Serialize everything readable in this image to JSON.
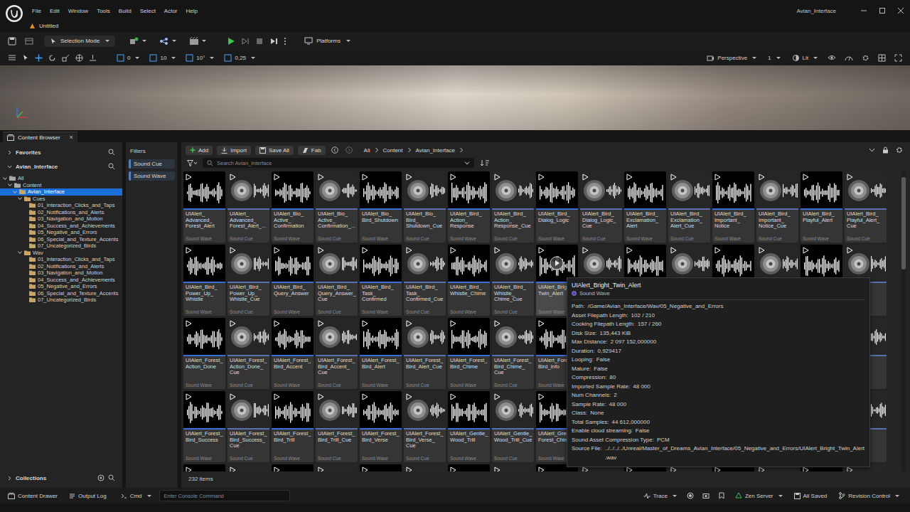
{
  "window": {
    "title": "Avian_Interface",
    "menu": [
      "File",
      "Edit",
      "Window",
      "Tools",
      "Build",
      "Select",
      "Actor",
      "Help"
    ],
    "level_tab": "Untitled"
  },
  "main_toolbar": {
    "mode": "Selection Mode",
    "platforms": "Platforms"
  },
  "viewport_toolbar": {
    "snaps": [
      "0",
      "10",
      "10°",
      "0,25"
    ],
    "view": "Perspective",
    "camera_speed": "1",
    "view_mode": "Lit"
  },
  "content_browser": {
    "tab": "Content Browser",
    "close": "×",
    "add": "Add",
    "import": "Import",
    "save_all": "Save All",
    "fab": "Fab",
    "breadcrumb": [
      "All",
      "Content",
      "Avian_Interface"
    ],
    "search_placeholder": "Search Avian_Interface",
    "item_count": "232 items"
  },
  "sidebar": {
    "favorites": "Favorites",
    "source": "Avian_Interface",
    "collections": "Collections",
    "tree": [
      {
        "label": "All",
        "depth": 0,
        "kind": "branch",
        "expanded": true,
        "selected": false
      },
      {
        "label": "Content",
        "depth": 1,
        "kind": "branch",
        "expanded": true,
        "selected": false
      },
      {
        "label": "Avian_Interface",
        "depth": 2,
        "kind": "branch",
        "expanded": true,
        "selected": true
      },
      {
        "label": "Cues",
        "depth": 3,
        "kind": "branch",
        "expanded": true,
        "selected": false
      },
      {
        "label": "01_Interaction_Clicks_and_Taps",
        "depth": 4,
        "kind": "leaf",
        "expanded": false,
        "selected": false
      },
      {
        "label": "02_Notifications_and_Alerts",
        "depth": 4,
        "kind": "leaf",
        "expanded": false,
        "selected": false
      },
      {
        "label": "03_Navigation_and_Motion",
        "depth": 4,
        "kind": "leaf",
        "expanded": false,
        "selected": false
      },
      {
        "label": "04_Success_and_Achievements",
        "depth": 4,
        "kind": "leaf",
        "expanded": false,
        "selected": false
      },
      {
        "label": "05_Negative_and_Errors",
        "depth": 4,
        "kind": "leaf",
        "expanded": false,
        "selected": false
      },
      {
        "label": "06_Special_and_Texture_Accents",
        "depth": 4,
        "kind": "leaf",
        "expanded": false,
        "selected": false
      },
      {
        "label": "07_Uncategorized_Birds",
        "depth": 4,
        "kind": "leaf",
        "expanded": false,
        "selected": false
      },
      {
        "label": "Wav",
        "depth": 3,
        "kind": "branch",
        "expanded": true,
        "selected": false
      },
      {
        "label": "01_Interaction_Clicks_and_Taps",
        "depth": 4,
        "kind": "leaf",
        "expanded": false,
        "selected": false
      },
      {
        "label": "02_Notifications_and_Alerts",
        "depth": 4,
        "kind": "leaf",
        "expanded": false,
        "selected": false
      },
      {
        "label": "03_Navigation_and_Motion",
        "depth": 4,
        "kind": "leaf",
        "expanded": false,
        "selected": false
      },
      {
        "label": "04_Success_and_Achievements",
        "depth": 4,
        "kind": "leaf",
        "expanded": false,
        "selected": false
      },
      {
        "label": "05_Negative_and_Errors",
        "depth": 4,
        "kind": "leaf",
        "expanded": false,
        "selected": false
      },
      {
        "label": "06_Special_and_Texture_Accents",
        "depth": 4,
        "kind": "leaf",
        "expanded": false,
        "selected": false
      },
      {
        "label": "07_Uncategorized_Birds",
        "depth": 4,
        "kind": "leaf",
        "expanded": false,
        "selected": false
      }
    ]
  },
  "filters": {
    "title": "Filters",
    "chips": [
      "Sound Cue",
      "Sound Wave"
    ]
  },
  "assets": [
    {
      "name": "UIAlert_Advanced_Forest_Alert",
      "type": "Sound Wave",
      "kind": "wave",
      "hovered": false
    },
    {
      "name": "UIAlert_Advanced_Forest_Alert_...",
      "type": "Sound Cue",
      "kind": "cue",
      "hovered": false
    },
    {
      "name": "UIAlert_Bio_Active_Confirmation",
      "type": "Sound Wave",
      "kind": "wave",
      "hovered": false
    },
    {
      "name": "UIAlert_Bio_Active_Confirmation_...",
      "type": "Sound Cue",
      "kind": "cue",
      "hovered": false
    },
    {
      "name": "UIAlert_Bio_Bird_Shutdown",
      "type": "Sound Wave",
      "kind": "wave",
      "hovered": false
    },
    {
      "name": "UIAlert_Bio_Bird_Shutdown_Cue",
      "type": "Sound Cue",
      "kind": "cue",
      "hovered": false
    },
    {
      "name": "UIAlert_Bird_Action_Response",
      "type": "Sound Wave",
      "kind": "wave",
      "hovered": false
    },
    {
      "name": "UIAlert_Bird_Action_Response_Cue",
      "type": "Sound Cue",
      "kind": "cue",
      "hovered": false
    },
    {
      "name": "UIAlert_Bird_Dialog_Logic",
      "type": "Sound Wave",
      "kind": "wave",
      "hovered": false
    },
    {
      "name": "UIAlert_Bird_Dialog_Logic_Cue",
      "type": "Sound Cue",
      "kind": "cue",
      "hovered": false
    },
    {
      "name": "UIAlert_Bird_Exclamation_Alert",
      "type": "Sound Wave",
      "kind": "wave",
      "hovered": false
    },
    {
      "name": "UIAlert_Bird_Exclamation_Alert_Cue",
      "type": "Sound Cue",
      "kind": "cue",
      "hovered": false
    },
    {
      "name": "UIAlert_Bird_Important_Notice",
      "type": "Sound Wave",
      "kind": "wave",
      "hovered": false
    },
    {
      "name": "UIAlert_Bird_Important_Notice_Cue",
      "type": "Sound Cue",
      "kind": "cue",
      "hovered": false
    },
    {
      "name": "UIAlert_Bird_Playful_Alert",
      "type": "Sound Wave",
      "kind": "wave",
      "hovered": false
    },
    {
      "name": "UIAlert_Bird_Playful_Alert_Cue",
      "type": "Sound Cue",
      "kind": "cue",
      "hovered": false
    },
    {
      "name": "UIAlert_Bird_Power_Up_Whistle",
      "type": "Sound Wave",
      "kind": "wave",
      "hovered": false
    },
    {
      "name": "UIAlert_Bird_Power_Up_Whistle_Cue",
      "type": "Sound Cue",
      "kind": "cue",
      "hovered": false
    },
    {
      "name": "UIAlert_Bird_Query_Answer",
      "type": "Sound Wave",
      "kind": "wave",
      "hovered": false
    },
    {
      "name": "UIAlert_Bird_Query_Answer_Cue",
      "type": "Sound Cue",
      "kind": "cue",
      "hovered": false
    },
    {
      "name": "UIAlert_Bird_Task_Confirmed",
      "type": "Sound Wave",
      "kind": "wave",
      "hovered": false
    },
    {
      "name": "UIAlert_Bird_Task_Confirmed_Cue",
      "type": "Sound Cue",
      "kind": "cue",
      "hovered": false
    },
    {
      "name": "UIAlert_Bird_Whistle_Chime",
      "type": "Sound Wave",
      "kind": "wave",
      "hovered": false
    },
    {
      "name": "UIAlert_Bird_Whistle_Chime_Cue",
      "type": "Sound Cue",
      "kind": "cue",
      "hovered": false
    },
    {
      "name": "UIAlert_Bright_Twin_Alert",
      "type": "Sound Wave",
      "kind": "wave",
      "hovered": true
    },
    {
      "name": "",
      "type": "",
      "kind": "cue",
      "hovered": false
    },
    {
      "name": "",
      "type": "",
      "kind": "wave",
      "hovered": false
    },
    {
      "name": "",
      "type": "",
      "kind": "cue",
      "hovered": false
    },
    {
      "name": "",
      "type": "",
      "kind": "wave",
      "hovered": false
    },
    {
      "name": "",
      "type": "",
      "kind": "cue",
      "hovered": false
    },
    {
      "name": "",
      "type": "",
      "kind": "wave",
      "hovered": false
    },
    {
      "name": "",
      "type": "",
      "kind": "cue",
      "hovered": false
    },
    {
      "name": "UIAlert_Forest_Action_Done",
      "type": "Sound Wave",
      "kind": "wave",
      "hovered": false
    },
    {
      "name": "UIAlert_Forest_Action_Done_Cue",
      "type": "Sound Cue",
      "kind": "cue",
      "hovered": false
    },
    {
      "name": "UIAlert_Forest_Bird_Accent",
      "type": "Sound Wave",
      "kind": "wave",
      "hovered": false
    },
    {
      "name": "UIAlert_Forest_Bird_Accent_Cue",
      "type": "Sound Cue",
      "kind": "cue",
      "hovered": false
    },
    {
      "name": "UIAlert_Forest_Bird_Alert",
      "type": "Sound Wave",
      "kind": "wave",
      "hovered": false
    },
    {
      "name": "UIAlert_Forest_Bird_Alert_Cue",
      "type": "Sound Cue",
      "kind": "cue",
      "hovered": false
    },
    {
      "name": "UIAlert_Forest_Bird_Chime",
      "type": "Sound Wave",
      "kind": "wave",
      "hovered": false
    },
    {
      "name": "UIAlert_Forest_Bird_Chime_Cue",
      "type": "Sound Cue",
      "kind": "cue",
      "hovered": false
    },
    {
      "name": "UIAlert_Forest_Bird_Info",
      "type": "Sound Wave",
      "kind": "wave",
      "hovered": false
    },
    {
      "name": "",
      "type": "",
      "kind": "cue",
      "hovered": false
    },
    {
      "name": "",
      "type": "",
      "kind": "wave",
      "hovered": false
    },
    {
      "name": "",
      "type": "",
      "kind": "cue",
      "hovered": false
    },
    {
      "name": "",
      "type": "",
      "kind": "wave",
      "hovered": false
    },
    {
      "name": "",
      "type": "",
      "kind": "cue",
      "hovered": false
    },
    {
      "name": "",
      "type": "",
      "kind": "wave",
      "hovered": false
    },
    {
      "name": "",
      "type": "",
      "kind": "cue",
      "hovered": false
    },
    {
      "name": "UIAlert_Forest_Bird_Success",
      "type": "Sound Wave",
      "kind": "wave",
      "hovered": false
    },
    {
      "name": "UIAlert_Forest_Bird_Success_Cue",
      "type": "Sound Cue",
      "kind": "cue",
      "hovered": false
    },
    {
      "name": "UIAlert_Forest_Bird_Trill",
      "type": "Sound Wave",
      "kind": "wave",
      "hovered": false
    },
    {
      "name": "UIAlert_Forest_Bird_Trill_Cue",
      "type": "Sound Cue",
      "kind": "cue",
      "hovered": false
    },
    {
      "name": "UIAlert_Forest_Bird_Verse",
      "type": "Sound Wave",
      "kind": "wave",
      "hovered": false
    },
    {
      "name": "UIAlert_Forest_Bird_Verse_Cue",
      "type": "Sound Cue",
      "kind": "cue",
      "hovered": false
    },
    {
      "name": "UIAlert_Gentle_Wood_Trill",
      "type": "Sound Wave",
      "kind": "wave",
      "hovered": false
    },
    {
      "name": "UIAlert_Gentle_Wood_Trill_Cue",
      "type": "Sound Cue",
      "kind": "cue",
      "hovered": false
    },
    {
      "name": "UIAlert_Green_Forest_Chime",
      "type": "Sound Wave",
      "kind": "wave",
      "hovered": false
    },
    {
      "name": "",
      "type": "",
      "kind": "cue",
      "hovered": false
    },
    {
      "name": "",
      "type": "",
      "kind": "wave",
      "hovered": false
    },
    {
      "name": "",
      "type": "",
      "kind": "cue",
      "hovered": false
    },
    {
      "name": "",
      "type": "",
      "kind": "wave",
      "hovered": false
    },
    {
      "name": "",
      "type": "",
      "kind": "cue",
      "hovered": false
    },
    {
      "name": "",
      "type": "",
      "kind": "wave",
      "hovered": false
    },
    {
      "name": "",
      "type": "",
      "kind": "cue",
      "hovered": false
    },
    {
      "name": "",
      "type": "",
      "kind": "wave",
      "hovered": false
    },
    {
      "name": "",
      "type": "",
      "kind": "cue",
      "hovered": false
    },
    {
      "name": "",
      "type": "",
      "kind": "wave",
      "hovered": false
    },
    {
      "name": "",
      "type": "",
      "kind": "cue",
      "hovered": false
    },
    {
      "name": "",
      "type": "",
      "kind": "wave",
      "hovered": false
    },
    {
      "name": "",
      "type": "",
      "kind": "cue",
      "hovered": false
    },
    {
      "name": "",
      "type": "",
      "kind": "wave",
      "hovered": false
    },
    {
      "name": "",
      "type": "",
      "kind": "cue",
      "hovered": false
    },
    {
      "name": "",
      "type": "",
      "kind": "wave",
      "hovered": false
    },
    {
      "name": "",
      "type": "",
      "kind": "cue",
      "hovered": false
    },
    {
      "name": "",
      "type": "",
      "kind": "wave",
      "hovered": false
    },
    {
      "name": "",
      "type": "",
      "kind": "cue",
      "hovered": false
    },
    {
      "name": "",
      "type": "",
      "kind": "wave",
      "hovered": false
    },
    {
      "name": "",
      "type": "",
      "kind": "cue",
      "hovered": false
    },
    {
      "name": "",
      "type": "",
      "kind": "wave",
      "hovered": false
    },
    {
      "name": "",
      "type": "",
      "kind": "cue",
      "hovered": false
    }
  ],
  "tooltip": {
    "title": "UIAlert_Bright_Twin_Alert",
    "type": "Sound Wave",
    "rows": [
      {
        "key": "Path:",
        "value": "/Game/Avian_Interface/Wav/05_Negative_and_Errors"
      },
      {
        "key": "Asset Filepath Length:",
        "value": "102 / 210"
      },
      {
        "key": "Cooking Filepath Length:",
        "value": "157 / 260"
      },
      {
        "key": "Disk Size:",
        "value": "135,443 KiB"
      },
      {
        "key": "Max Distance:",
        "value": "2 097 152,000000"
      },
      {
        "key": "Duration:",
        "value": "0,929417"
      },
      {
        "key": "Looping:",
        "value": "False"
      },
      {
        "key": "Mature:",
        "value": "False"
      },
      {
        "key": "Compression:",
        "value": "80"
      },
      {
        "key": "Imported Sample Rate:",
        "value": "48 000"
      },
      {
        "key": "Num Channels:",
        "value": "2"
      },
      {
        "key": "Sample Rate:",
        "value": "48 000"
      },
      {
        "key": "Class:",
        "value": "None"
      },
      {
        "key": "Total Samples:",
        "value": "44 612,000000"
      },
      {
        "key": "Enable cloud streaming:",
        "value": "False"
      },
      {
        "key": "Sound Asset Compression Type:",
        "value": "PCM"
      },
      {
        "key": "Source File:",
        "value": "../../../../Unreal/Master_of_Dreams_Avian_Interface/05_Negative_and_Errors/UIAlert_Bright_Twin_Alert.wav"
      }
    ]
  },
  "status_bar": {
    "content_drawer": "Content Drawer",
    "output_log": "Output Log",
    "cmd": "Cmd",
    "console_placeholder": "Enter Console Command",
    "trace": "Trace",
    "zen_server": "Zen Server",
    "saved": "All Saved",
    "revision_control": "Revision Control"
  }
}
